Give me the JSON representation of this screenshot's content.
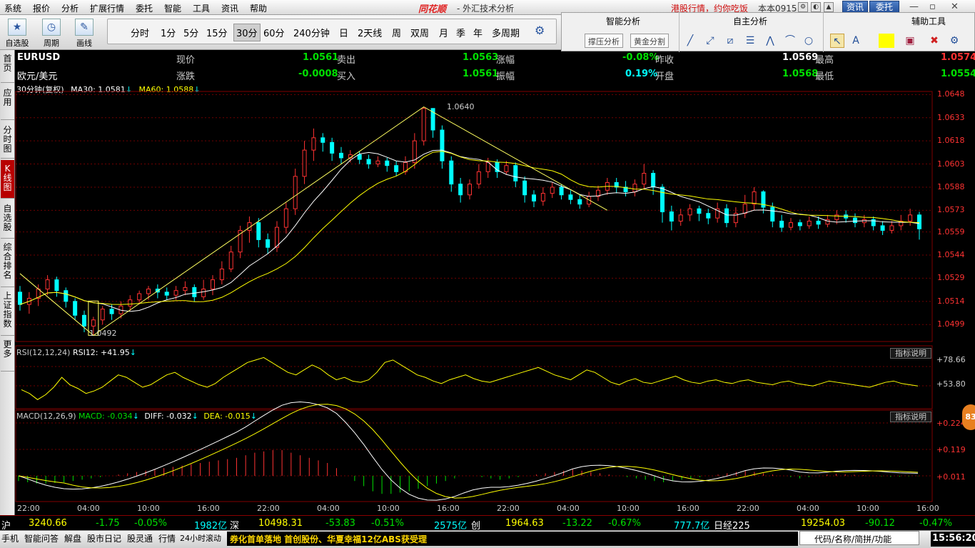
{
  "menu": [
    "系统",
    "报价",
    "分析",
    "扩展行情",
    "委托",
    "智能",
    "工具",
    "资讯",
    "帮助"
  ],
  "brand": "同花顺",
  "app_title": "- 外汇技术分析",
  "promo": "港股行情，约你吃饭",
  "version": "本本0915",
  "btn_news": "资讯",
  "btn_trade": "委托",
  "toolbar_big": [
    {
      "label": "自选股",
      "icon": "★"
    },
    {
      "label": "周期",
      "icon": "◷"
    },
    {
      "label": "画线",
      "icon": "✎"
    }
  ],
  "periods": [
    "分时",
    "1分",
    "5分",
    "15分",
    "30分",
    "60分",
    "240分钟",
    "日",
    "2天线",
    "周",
    "双周",
    "月",
    "季",
    "年",
    "多周期"
  ],
  "selected_period": "30分",
  "rp": {
    "smart": "智能分析",
    "self": "自主分析",
    "aux": "辅助工具",
    "btn1": "撑压分析",
    "btn2": "黄金分割"
  },
  "sidebar": [
    "首页",
    "应用",
    "分时图",
    "K线图",
    "自选股",
    "综合排名",
    "上证指数",
    "更多"
  ],
  "quote": {
    "code": "EURUSD",
    "name": "欧元/美元",
    "l_now": "现价",
    "v_now": "1.0561",
    "l_sell": "卖出",
    "v_sell": "1.0563",
    "l_up": "涨幅",
    "v_up": "-0.08%",
    "l_prev": "昨收",
    "v_prev": "1.0569",
    "l_high": "最高",
    "v_high": "1.0574",
    "l_chg": "涨跌",
    "v_chg": "-0.0008",
    "l_buy": "买入",
    "v_buy": "1.0561",
    "l_amp": "振幅",
    "v_amp": "0.19%",
    "l_open": "开盘",
    "v_open": "1.0568",
    "l_low": "最低",
    "v_low": "1.0554"
  },
  "ma": {
    "title": "30分钟(复权)",
    "ma30": "MA30: 1.0581",
    "ma60": "MA60: 1.0588"
  },
  "rsi": {
    "title": "RSI(12,12,24)",
    "val": "RSI12: +41.95",
    "levels": [
      "+78.66",
      "+53.80"
    ]
  },
  "macd": {
    "title": "MACD(12,26,9)",
    "macd": "MACD: -0.034",
    "diff": "DIFF: -0.032",
    "dea": "DEA: -0.015",
    "levels": [
      "+0.224",
      "+0.119",
      "+0.011"
    ]
  },
  "indicator_btn": "指标说明",
  "high_label": "1.0640",
  "low_label": "1.0492",
  "price_axis": [
    "1.0648",
    "1.0633",
    "1.0618",
    "1.0603",
    "1.0588",
    "1.0573",
    "1.0559",
    "1.0544",
    "1.0529",
    "1.0514",
    "1.0499"
  ],
  "time_axis": [
    "22:00",
    "04:00",
    "10:00",
    "16:00",
    "22:00",
    "04:00",
    "10:00",
    "16:00",
    "22:00",
    "04:00",
    "10:00",
    "16:00",
    "22:00",
    "04:00",
    "10:00",
    "16:00"
  ],
  "ticker": {
    "sh": "沪",
    "sh_v": "3240.66",
    "sh_c": "-1.75",
    "sh_p": "-0.05%",
    "sh_a": "1982亿",
    "sz": "深",
    "sz_v": "10498.31",
    "sz_c": "-53.83",
    "sz_p": "-0.51%",
    "sz_a": "2575亿",
    "cy": "创",
    "cy_v": "1964.63",
    "cy_c": "-13.22",
    "cy_p": "-0.67%",
    "cy_a": "777.7亿",
    "nk": "日经225",
    "nk_v": "19254.03",
    "nk_c": "-90.12",
    "nk_p": "-0.47%"
  },
  "bottom": {
    "items": [
      "手机",
      "智能问答",
      "解盘",
      "股市日记",
      "股灵通",
      "行情",
      "24小时滚动"
    ],
    "marquee": "券化首单落地 首创股份、华夏幸福12亿ABS获受理",
    "search": "代码/名称/简拼/功能",
    "clock": "15:56:20"
  },
  "badge": "83",
  "chart_data": {
    "type": "candlestick",
    "ylim": [
      1.0488,
      1.065
    ],
    "high": 1.064,
    "low": 1.0492,
    "candles": [
      [
        1.052,
        1.0512,
        1.0524,
        1.0508
      ],
      [
        1.0512,
        1.0516,
        1.052,
        1.0506
      ],
      [
        1.0516,
        1.0522,
        1.0525,
        1.0511
      ],
      [
        1.0522,
        1.0528,
        1.0531,
        1.0518
      ],
      [
        1.0528,
        1.0521,
        1.053,
        1.0517
      ],
      [
        1.0521,
        1.0514,
        1.0523,
        1.051
      ],
      [
        1.0514,
        1.0505,
        1.0516,
        1.0502
      ],
      [
        1.0505,
        1.0498,
        1.0508,
        1.0494
      ],
      [
        1.0498,
        1.0502,
        1.0504,
        1.0492
      ],
      [
        1.0502,
        1.0509,
        1.0511,
        1.0499
      ],
      [
        1.0509,
        1.0506,
        1.0512,
        1.0502
      ],
      [
        1.0506,
        1.0511,
        1.0514,
        1.0503
      ],
      [
        1.0511,
        1.0515,
        1.0518,
        1.0508
      ],
      [
        1.0515,
        1.0519,
        1.0521,
        1.0512
      ],
      [
        1.0519,
        1.0522,
        1.0524,
        1.0515
      ],
      [
        1.0522,
        1.052,
        1.0525,
        1.0516
      ],
      [
        1.052,
        1.0518,
        1.0523,
        1.0515
      ],
      [
        1.0518,
        1.0521,
        1.0524,
        1.0515
      ],
      [
        1.0521,
        1.0523,
        1.0527,
        1.0518
      ],
      [
        1.0523,
        1.0517,
        1.0525,
        1.0514
      ],
      [
        1.0517,
        1.0522,
        1.0528,
        1.0515
      ],
      [
        1.0522,
        1.0528,
        1.0531,
        1.0518
      ],
      [
        1.0528,
        1.0535,
        1.054,
        1.0525
      ],
      [
        1.0535,
        1.0546,
        1.055,
        1.0533
      ],
      [
        1.0546,
        1.056,
        1.0563,
        1.0542
      ],
      [
        1.056,
        1.0565,
        1.0569,
        1.0552
      ],
      [
        1.0565,
        1.0554,
        1.0568,
        1.0549
      ],
      [
        1.0554,
        1.0549,
        1.0558,
        1.0545
      ],
      [
        1.0549,
        1.0562,
        1.0566,
        1.0546
      ],
      [
        1.0562,
        1.0574,
        1.0578,
        1.0558
      ],
      [
        1.0574,
        1.0595,
        1.06,
        1.057
      ],
      [
        1.0595,
        1.0612,
        1.0618,
        1.059
      ],
      [
        1.0612,
        1.062,
        1.0626,
        1.0605
      ],
      [
        1.062,
        1.0617,
        1.0623,
        1.0611
      ],
      [
        1.0617,
        1.061,
        1.062,
        1.0605
      ],
      [
        1.061,
        1.0607,
        1.0614,
        1.0603
      ],
      [
        1.0607,
        1.0609,
        1.0612,
        1.0604
      ],
      [
        1.0609,
        1.0606,
        1.0611,
        1.0603
      ],
      [
        1.0606,
        1.0603,
        1.0609,
        1.06
      ],
      [
        1.0603,
        1.0605,
        1.0608,
        1.0601
      ],
      [
        1.0605,
        1.0602,
        1.0607,
        1.0598
      ],
      [
        1.0602,
        1.0598,
        1.0605,
        1.0595
      ],
      [
        1.0598,
        1.0604,
        1.0608,
        1.0596
      ],
      [
        1.0604,
        1.0618,
        1.0623,
        1.06
      ],
      [
        1.0618,
        1.0639,
        1.064,
        1.0615
      ],
      [
        1.0639,
        1.0625,
        1.0638,
        1.062
      ],
      [
        1.0625,
        1.0605,
        1.0628,
        1.06
      ],
      [
        1.0605,
        1.059,
        1.0608,
        1.0585
      ],
      [
        1.059,
        1.0583,
        1.0594,
        1.0578
      ],
      [
        1.0583,
        1.059,
        1.0593,
        1.058
      ],
      [
        1.059,
        1.0598,
        1.0603,
        1.0587
      ],
      [
        1.0598,
        1.0604,
        1.0607,
        1.0594
      ],
      [
        1.0604,
        1.0598,
        1.0606,
        1.0594
      ],
      [
        1.0598,
        1.0602,
        1.0605,
        1.0596
      ],
      [
        1.0602,
        1.0592,
        1.0604,
        1.0588
      ],
      [
        1.0592,
        1.0583,
        1.0595,
        1.0578
      ],
      [
        1.0583,
        1.0579,
        1.0586,
        1.0575
      ],
      [
        1.0579,
        1.0584,
        1.0588,
        1.0576
      ],
      [
        1.0584,
        1.0588,
        1.0591,
        1.0581
      ],
      [
        1.0588,
        1.0583,
        1.059,
        1.058
      ],
      [
        1.0583,
        1.058,
        1.0586,
        1.0577
      ],
      [
        1.058,
        1.0577,
        1.0583,
        1.0574
      ],
      [
        1.0577,
        1.0582,
        1.0585,
        1.0575
      ],
      [
        1.0582,
        1.0586,
        1.0589,
        1.0579
      ],
      [
        1.0586,
        1.0591,
        1.0594,
        1.0583
      ],
      [
        1.0591,
        1.0588,
        1.0594,
        1.0584
      ],
      [
        1.0588,
        1.0585,
        1.0592,
        1.0582
      ],
      [
        1.0585,
        1.059,
        1.0593,
        1.0582
      ],
      [
        1.059,
        1.0597,
        1.0603,
        1.0587
      ],
      [
        1.0597,
        1.0588,
        1.0599,
        1.0583
      ],
      [
        1.0588,
        1.0572,
        1.059,
        1.0565
      ],
      [
        1.0572,
        1.0566,
        1.0576,
        1.056
      ],
      [
        1.0566,
        1.057,
        1.0574,
        1.0563
      ],
      [
        1.057,
        1.0574,
        1.0577,
        1.0566
      ],
      [
        1.0574,
        1.0571,
        1.0576,
        1.0566
      ],
      [
        1.0571,
        1.0568,
        1.0574,
        1.0564
      ],
      [
        1.0568,
        1.0574,
        1.0578,
        1.0565
      ],
      [
        1.0574,
        1.0565,
        1.0577,
        1.0562
      ],
      [
        1.0565,
        1.0571,
        1.0575,
        1.0562
      ],
      [
        1.0571,
        1.0577,
        1.0583,
        1.0568
      ],
      [
        1.0577,
        1.0585,
        1.0588,
        1.0573
      ],
      [
        1.0585,
        1.0575,
        1.0586,
        1.0571
      ],
      [
        1.0575,
        1.0566,
        1.0578,
        1.0562
      ],
      [
        1.0566,
        1.0562,
        1.057,
        1.0559
      ],
      [
        1.0562,
        1.0565,
        1.0568,
        1.056
      ],
      [
        1.0565,
        1.0563,
        1.0567,
        1.056
      ],
      [
        1.0563,
        1.0566,
        1.0569,
        1.0561
      ],
      [
        1.0566,
        1.0564,
        1.0569,
        1.0561
      ],
      [
        1.0564,
        1.0567,
        1.057,
        1.0562
      ],
      [
        1.0567,
        1.057,
        1.0573,
        1.0564
      ],
      [
        1.057,
        1.0568,
        1.0573,
        1.0565
      ],
      [
        1.0568,
        1.0565,
        1.0571,
        1.0562
      ],
      [
        1.0565,
        1.0567,
        1.057,
        1.0562
      ],
      [
        1.0567,
        1.0563,
        1.0569,
        1.056
      ],
      [
        1.0563,
        1.056,
        1.0566,
        1.0557
      ],
      [
        1.056,
        1.0563,
        1.0566,
        1.0558
      ],
      [
        1.0563,
        1.0566,
        1.057,
        1.056
      ],
      [
        1.0566,
        1.057,
        1.0574,
        1.0563
      ],
      [
        1.057,
        1.0561,
        1.0572,
        1.0554
      ]
    ],
    "rsi": [
      48,
      45,
      40,
      44,
      50,
      58,
      52,
      49,
      45,
      47,
      50,
      55,
      60,
      58,
      54,
      50,
      52,
      56,
      60,
      62,
      58,
      55,
      52,
      50,
      53,
      58,
      62,
      66,
      70,
      72,
      74,
      70,
      66,
      62,
      60,
      64,
      68,
      65,
      60,
      56,
      58,
      55,
      54,
      56,
      62,
      70,
      72,
      68,
      64,
      60,
      58,
      55,
      53,
      56,
      58,
      60,
      57,
      55,
      54,
      56,
      58,
      60,
      62,
      64,
      66,
      63,
      60,
      58,
      56,
      60,
      64,
      62,
      58,
      54,
      52,
      55,
      57,
      54,
      53,
      55,
      57,
      59,
      56,
      54,
      53,
      55,
      56,
      54,
      53,
      55,
      56,
      54,
      53,
      52,
      54,
      55,
      53,
      52,
      51,
      53,
      55,
      54,
      53,
      52,
      51,
      50,
      52,
      54,
      55,
      53,
      52,
      51
    ],
    "macd_hist": [
      -0.02,
      -0.025,
      -0.03,
      -0.03,
      -0.028,
      -0.025,
      -0.02,
      -0.015,
      -0.01,
      -0.005,
      0.0,
      0.005,
      0.01,
      0.015,
      0.02,
      0.025,
      0.03,
      0.035,
      0.04,
      0.045,
      0.05,
      0.055,
      0.06,
      0.065,
      0.07,
      0.08,
      0.09,
      0.095,
      0.1,
      0.1,
      0.09,
      0.08,
      0.07,
      0.06,
      0.05,
      0.03,
      0.0,
      -0.02,
      -0.04,
      -0.06,
      -0.07,
      -0.07,
      -0.065,
      -0.06,
      -0.05,
      -0.04,
      -0.03,
      -0.02,
      -0.01,
      0.0,
      0.0,
      -0.005,
      -0.01,
      -0.015,
      -0.01,
      -0.005,
      0.0,
      0.005,
      0.01,
      0.015,
      0.02,
      0.025,
      0.02,
      0.015,
      0.01,
      0.005,
      0.0,
      -0.005,
      -0.01,
      -0.015,
      -0.02,
      -0.025,
      -0.02,
      -0.015,
      -0.01,
      -0.005,
      0.0,
      0.005,
      0.01,
      0.015,
      0.02,
      0.015,
      0.01,
      0.005,
      0.0,
      -0.005,
      -0.01,
      -0.005,
      0.0,
      0.005,
      0.008,
      0.006,
      0.004,
      0.002,
      0.0,
      -0.002,
      -0.004,
      -0.003,
      -0.002,
      -0.001
    ]
  }
}
